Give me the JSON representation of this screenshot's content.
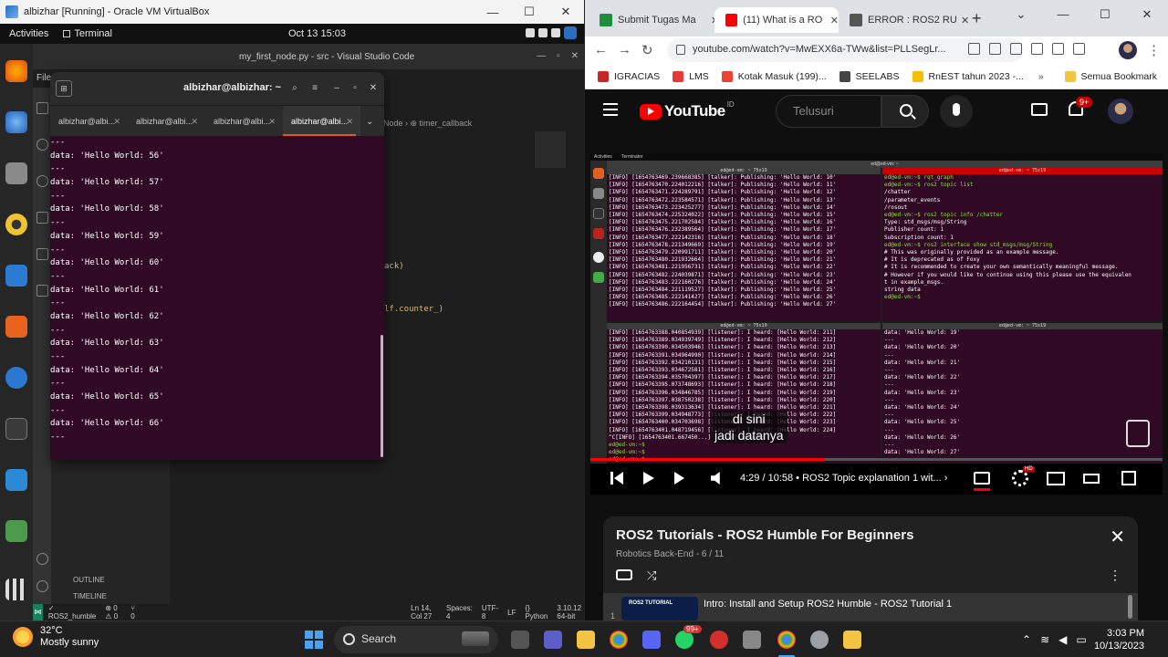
{
  "vbox": {
    "title": "albizhar [Running] - Oracle VM VirtualBox",
    "minimize": "—",
    "maximize": "☐",
    "close": "✕"
  },
  "gnome": {
    "activities": "Activities",
    "app": "Terminal",
    "clock": "Oct 13  15:03"
  },
  "vscode": {
    "title": "my_first_node.py - src - Visual Studio Code",
    "menu_file": "File",
    "breadcrumb": "Node › ⊕ timer_callback",
    "code_fragment_1": "ack)",
    "code_fragment_2": "lf.counter_)",
    "outline": "OUTLINE",
    "timeline": "TIMELINE",
    "status_branch": "✓ ROS2_humble",
    "status_errors": "⊗ 0  ⚠ 0",
    "status_ports": "⑂ 0",
    "status_position": "Ln 14, Col 27",
    "status_spaces": "Spaces: 4",
    "status_encoding": "UTF-8",
    "status_eol": "LF",
    "status_language": "{} Python",
    "status_python": "3.10.12 64-bit"
  },
  "terminal": {
    "title": "albizhar@albizhar: ~",
    "tabs": [
      {
        "label": "albizhar@albi..."
      },
      {
        "label": "albizhar@albi..."
      },
      {
        "label": "albizhar@albi..."
      },
      {
        "label": "albizhar@albi..."
      }
    ],
    "lines": [
      "---",
      "data: 'Hello World: 56'",
      "---",
      "data: 'Hello World: 57'",
      "---",
      "data: 'Hello World: 58'",
      "---",
      "data: 'Hello World: 59'",
      "---",
      "data: 'Hello World: 60'",
      "---",
      "data: 'Hello World: 61'",
      "---",
      "data: 'Hello World: 62'",
      "---",
      "data: 'Hello World: 63'",
      "---",
      "data: 'Hello World: 64'",
      "---",
      "data: 'Hello World: 65'",
      "---",
      "data: 'Hello World: 66'",
      "---"
    ]
  },
  "chrome": {
    "tabs": [
      {
        "label": "Submit Tugas Ma",
        "color": "#1e8e3e"
      },
      {
        "label": "(11) What is a RO",
        "color": "#ff0000"
      },
      {
        "label": "ERROR : ROS2 RU",
        "color": "#555555"
      }
    ],
    "new_tab": "+",
    "url": "youtube.com/watch?v=MwEXX6a-TWw&list=PLLSegLr...",
    "bookmarks": [
      {
        "label": "IGRACIAS",
        "color": "#c62828"
      },
      {
        "label": "LMS",
        "color": "#e53935"
      },
      {
        "label": "Kotak Masuk (199)...",
        "color": "#ea4335"
      },
      {
        "label": "SEELABS",
        "color": "#444444"
      },
      {
        "label": "RnEST tahun 2023 -...",
        "color": "#fbbc04"
      }
    ],
    "bookmarks_more": "»",
    "bookmarks_folder": "Semua Bookmark"
  },
  "youtube": {
    "logo": "YouTube",
    "region": "ID",
    "search_placeholder": "Telusuri",
    "notifications": "9+",
    "player": {
      "time": "4:29 / 10:58  •  ROS2 Topic explanation 1 wit...  ›",
      "progress": 0.41,
      "caption_line1": "di sini",
      "caption_line2": "jadi datanya"
    },
    "video_terminal": {
      "activities": "Activities",
      "app": "Terminator",
      "title": "ed@ed-vm: ~",
      "pane_header": "ed@ed-vm: ~ 75x19",
      "talker_lines": [
        "[INFO] [1654763469.239668385] [talker]: Publishing: 'Hello World: 10'",
        "[INFO] [1654763470.224012216] [talker]: Publishing: 'Hello World: 11'",
        "[INFO] [1654763471.224289791] [talker]: Publishing: 'Hello World: 12'",
        "[INFO] [1654763472.223584571] [talker]: Publishing: 'Hello World: 13'",
        "[INFO] [1654763473.223425277] [talker]: Publishing: 'Hello World: 14'",
        "[INFO] [1654763474.225324022] [talker]: Publishing: 'Hello World: 15'",
        "[INFO] [1654763475.221702584] [talker]: Publishing: 'Hello World: 16'",
        "[INFO] [1654763476.232389564] [talker]: Publishing: 'Hello World: 17'",
        "[INFO] [1654763477.222142316] [talker]: Publishing: 'Hello World: 18'",
        "[INFO] [1654763478.221349669] [talker]: Publishing: 'Hello World: 19'",
        "[INFO] [1654763479.220991711] [talker]: Publishing: 'Hello World: 20'",
        "[INFO] [1654763480.221932664] [talker]: Publishing: 'Hello World: 21'",
        "[INFO] [1654763481.221956731] [talker]: Publishing: 'Hello World: 22'",
        "[INFO] [1654763482.224039871] [talker]: Publishing: 'Hello World: 23'",
        "[INFO] [1654763483.222160276] [talker]: Publishing: 'Hello World: 24'",
        "[INFO] [1654763484.221119527] [talker]: Publishing: 'Hello World: 25'",
        "[INFO] [1654763485.222141427] [talker]: Publishing: 'Hello World: 26'",
        "[INFO] [1654763486.222164454] [talker]: Publishing: 'Hello World: 27'"
      ],
      "topic_lines": [
        "ed@ed-vm:~$ rqt_graph",
        "ed@ed-vm:~$ ros2 topic list",
        "/chatter",
        "/parameter_events",
        "/rosout",
        "ed@ed-vm:~$ ros2 topic info /chatter",
        "Type: std_msgs/msg/String",
        "Publisher count: 1",
        "Subscription count: 1",
        "ed@ed-vm:~$ ros2 interface show std_msgs/msg/String",
        "# This was originally provided as an example message.",
        "# It is deprecated as of Foxy",
        "# It is recommended to create your own semantically meaningful message.",
        "# However if you would like to continue using this please use the equivalen",
        "t in example_msgs.",
        "",
        "string data",
        "ed@ed-vm:~$"
      ],
      "listener_lines": [
        "[INFO] [1654763388.040854939] [listener]: I heard: [Hello World: 211]",
        "[INFO] [1654763389.034939749] [listener]: I heard: [Hello World: 212]",
        "[INFO] [1654763390.034503946] [listener]: I heard: [Hello World: 213]",
        "[INFO] [1654763391.034964990] [listener]: I heard: [Hello World: 214]",
        "[INFO] [1654763392.034210131] [listener]: I heard: [Hello World: 215]",
        "[INFO] [1654763393.034672581] [listener]: I heard: [Hello World: 216]",
        "[INFO] [1654763394.035704397] [listener]: I heard: [Hello World: 217]",
        "[INFO] [1654763395.073748693] [listener]: I heard: [Hello World: 218]",
        "[INFO] [1654763396.034846785] [listener]: I heard: [Hello World: 219]",
        "[INFO] [1654763397.038750238] [listener]: I heard: [Hello World: 220]",
        "[INFO] [1654763398.039313634] [listener]: I heard: [Hello World: 221]",
        "[INFO] [1654763399.034948773] [listener]: I heard: [Hello World: 222]",
        "[INFO] [1654763400.034703698] [listener]: I heard: [Hello World: 223]",
        "[INFO] [1654763401.048719456] [listener]: I heard: [Hello World: 224]",
        "^C[INFO] [1654763401.667450...] ...ler(signum=2)",
        "ed@ed-vm:~$",
        "ed@ed-vm:~$",
        "ed@ed-vm:~$"
      ],
      "echo_lines": [
        "data: 'Hello World: 19'",
        "---",
        "data: 'Hello World: 20'",
        "---",
        "data: 'Hello World: 21'",
        "---",
        "data: 'Hello World: 22'",
        "---",
        "data: 'Hello World: 23'",
        "---",
        "data: 'Hello World: 24'",
        "---",
        "data: 'Hello World: 25'",
        "---",
        "data: 'Hello World: 26'",
        "---",
        "data: 'Hello World: 27'",
        "---"
      ]
    },
    "playlist": {
      "title": "ROS2 Tutorials - ROS2 Humble For Beginners",
      "subtitle": "Robotics Back-End - 6 / 11",
      "item_index": "1",
      "item_thumb": "ROS2 TUTORIAL",
      "item_title": "Intro: Install and Setup ROS2 Humble - ROS2 Tutorial 1"
    }
  },
  "taskbar": {
    "temp": "32°C",
    "weather": "Mostly sunny",
    "search": "Search",
    "whatsapp_badge": "99+",
    "time": "3:03 PM",
    "date": "10/13/2023"
  }
}
